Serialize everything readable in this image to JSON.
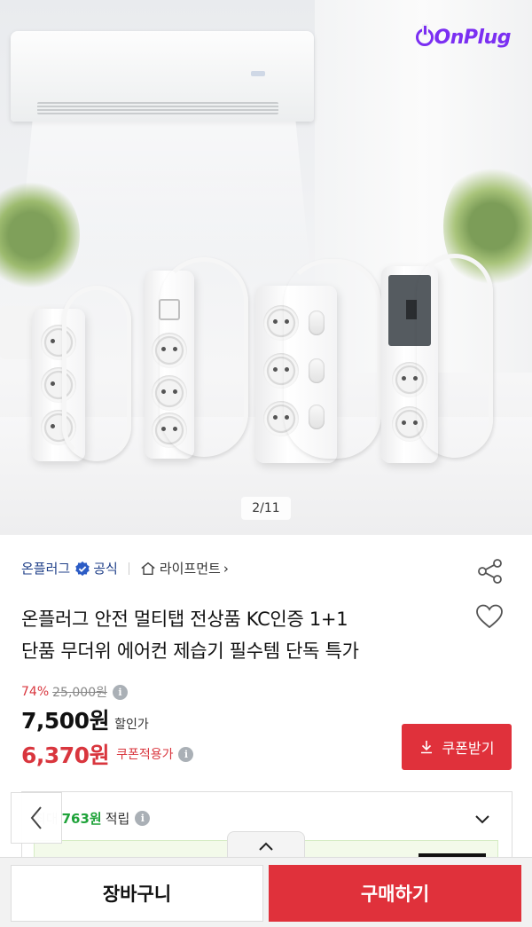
{
  "hero": {
    "brand_logo": "OnPlug",
    "image_counter": "2/11"
  },
  "seller": {
    "name": "온플러그",
    "badge": "공식",
    "category": "라이프먼트",
    "category_chevron": "›"
  },
  "product": {
    "title_line1": "온플러그 안전 멀티탭 전상품 KC인증 1+1",
    "title_line2": "단품 무더위 에어컨 제습기 필수템 단독 특가"
  },
  "price": {
    "discount_percent": "74%",
    "original_price": "25,000원",
    "sale_price": "7,500원",
    "sale_label": "할인가",
    "coupon_price": "6,370원",
    "coupon_label": "쿠폰적용가",
    "info_glyph": "i"
  },
  "coupon_button": {
    "label": "쿠폰받기"
  },
  "points": {
    "prefix": "최대",
    "amount": "763원",
    "label": "적립"
  },
  "bottom_bar": {
    "cart_label": "장바구니",
    "buy_label": "구매하기"
  },
  "colors": {
    "accent_red": "#e0313b",
    "seller_blue": "#1f3f88",
    "points_green": "#1fa33a",
    "logo_purple": "#7b2ff2"
  },
  "icons": [
    "verified-check-icon",
    "home-icon",
    "share-icon",
    "heart-icon",
    "info-icon",
    "download-icon",
    "chevron-down-icon",
    "chevron-left-icon",
    "chevron-up-icon"
  ]
}
